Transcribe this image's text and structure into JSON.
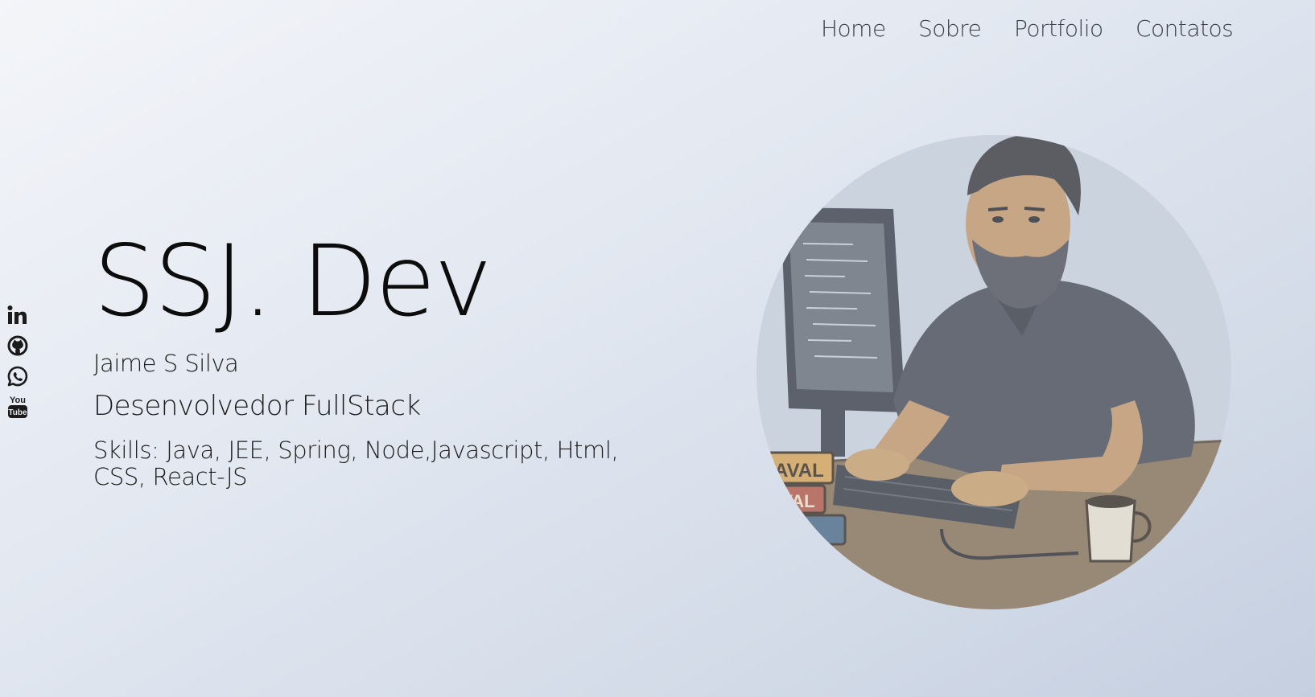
{
  "nav": {
    "items": [
      "Home",
      "Sobre",
      "Portfolio",
      "Contatos"
    ]
  },
  "social": {
    "icons": [
      "linkedin-icon",
      "github-icon",
      "whatsapp-icon",
      "youtube-icon"
    ],
    "youtube_logo_text": [
      "You",
      "Tube"
    ]
  },
  "hero": {
    "title": "SSJ. Dev",
    "name": "Jaime S Silva",
    "role": "Desenvolvedor FullStack",
    "skills": "Skills: Java, JEE, Spring, Node,Javascript, Html, CSS, React-JS"
  },
  "portrait": {
    "book_texts": [
      "AVAL",
      "AVAL"
    ]
  },
  "colors": {
    "nav_text": "#3a3f49",
    "body_text": "#111111",
    "background_start": "#f3f5f9",
    "background_end": "#c5cfe0"
  }
}
